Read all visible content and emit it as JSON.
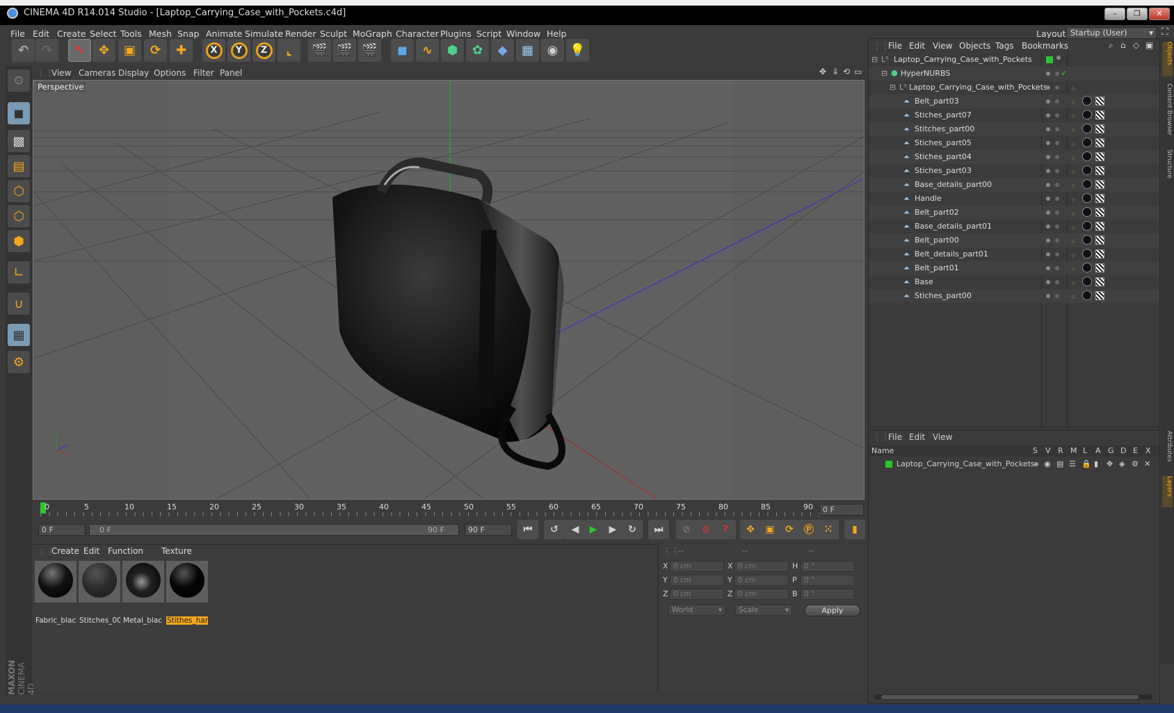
{
  "window": {
    "title": "CINEMA 4D R14.014 Studio - [Laptop_Carrying_Case_with_Pockets.c4d]",
    "min": "–",
    "max": "❐",
    "close": "✕"
  },
  "menu": [
    "File",
    "Edit",
    "Create",
    "Select",
    "Tools",
    "Mesh",
    "Snap",
    "Animate",
    "Simulate",
    "Render",
    "Sculpt",
    "MoGraph",
    "Character",
    "Plugins",
    "Script",
    "Window",
    "Help"
  ],
  "layout": {
    "label": "Layout:",
    "value": "Startup (User)"
  },
  "viewport": {
    "menu": [
      "View",
      "Cameras",
      "Display",
      "Options",
      "Filter",
      "Panel"
    ],
    "label": "Perspective"
  },
  "timeline": {
    "ticks": [
      "0",
      "5",
      "10",
      "15",
      "20",
      "25",
      "30",
      "35",
      "40",
      "45",
      "50",
      "55",
      "60",
      "65",
      "70",
      "75",
      "80",
      "85",
      "90"
    ],
    "frame_field": "0 F",
    "start": "0 F",
    "range_start": "0 F",
    "range_end": "90 F",
    "end": "90 F"
  },
  "materials": {
    "menu": [
      "Create",
      "Edit",
      "Function",
      "Texture"
    ],
    "items": [
      {
        "name": "Fabric_blac",
        "selected": false
      },
      {
        "name": "Stitches_00",
        "selected": false
      },
      {
        "name": "Metal_blac",
        "selected": false
      },
      {
        "name": "Stithes_har",
        "selected": true
      }
    ]
  },
  "coords": {
    "headers": [
      "--",
      "--",
      "--"
    ],
    "rows": [
      {
        "a": "X",
        "av": "0 cm",
        "b": "X",
        "bv": "0 cm",
        "c": "H",
        "cv": "0 °"
      },
      {
        "a": "Y",
        "av": "0 cm",
        "b": "Y",
        "bv": "0 cm",
        "c": "P",
        "cv": "0 °"
      },
      {
        "a": "Z",
        "av": "0 cm",
        "b": "Z",
        "bv": "0 cm",
        "c": "B",
        "cv": "0 °"
      }
    ],
    "world": "World",
    "scale": "Scale",
    "apply": "Apply"
  },
  "objects": {
    "menu": [
      "File",
      "Edit",
      "View",
      "Objects",
      "Tags",
      "Bookmarks"
    ],
    "root": "Laptop_Carrying_Case_with_Pockets",
    "hypernurbs": "HyperNURBS",
    "group": "Laptop_Carrying_Case_with_Pockets",
    "children": [
      "Belt_part03",
      "Stiches_part07",
      "Stitches_part00",
      "Stiches_part05",
      "Stiches_part04",
      "Stiches_part03",
      "Base_details_part00",
      "Handle",
      "Belt_part02",
      "Base_details_part01",
      "Belt_part00",
      "Belt_details_part01",
      "Belt_part01",
      "Base",
      "Stiches_part00"
    ]
  },
  "layers": {
    "menu": [
      "File",
      "Edit",
      "View"
    ],
    "cols": {
      "name": "Name",
      "flags": [
        "S",
        "V",
        "R",
        "M",
        "L",
        "A",
        "G",
        "D",
        "E",
        "X"
      ]
    },
    "rows": [
      "Laptop_Carrying_Case_with_Pockets"
    ]
  },
  "sidetabs": [
    "Objects",
    "Content Browser",
    "Structure",
    "Attributes",
    "Layers"
  ],
  "brand": {
    "top": "MAXON",
    "bottom": "CINEMA 4D"
  }
}
